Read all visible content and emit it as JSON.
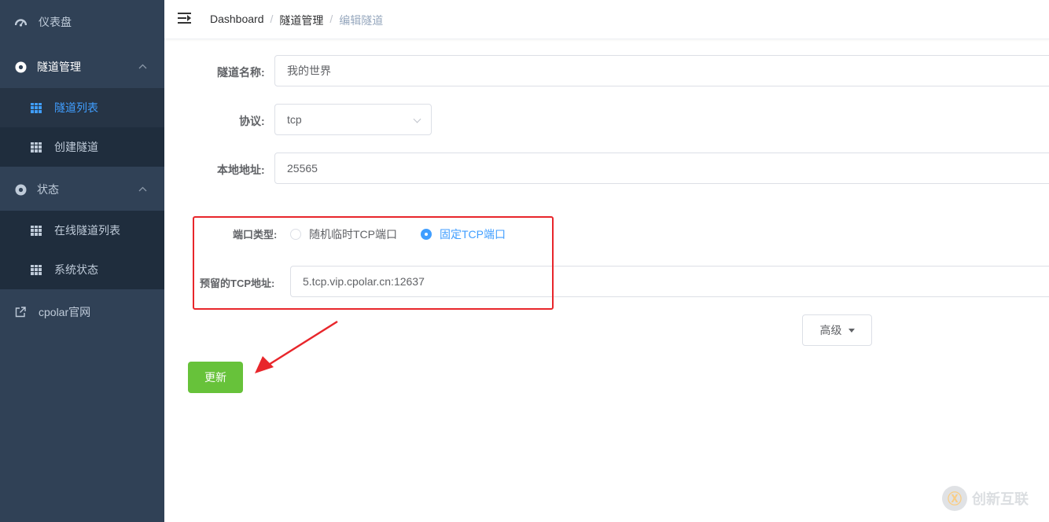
{
  "sidebar": {
    "dashboard": {
      "label": "仪表盘",
      "icon": "dashboard-gauge-icon"
    },
    "tunnel_group": {
      "label": "隧道管理",
      "icon": "disc-icon",
      "items": [
        {
          "label": "隧道列表",
          "icon": "grid-icon",
          "active": true
        },
        {
          "label": "创建隧道",
          "icon": "grid-icon"
        }
      ]
    },
    "status_group": {
      "label": "状态",
      "icon": "disc-icon",
      "items": [
        {
          "label": "在线隧道列表",
          "icon": "grid-icon"
        },
        {
          "label": "系统状态",
          "icon": "grid-icon"
        }
      ]
    },
    "external_link": {
      "label": "cpolar官网",
      "icon": "external-link-icon"
    }
  },
  "header": {
    "breadcrumb": [
      "Dashboard",
      "隧道管理",
      "编辑隧道"
    ],
    "separator": "/"
  },
  "form": {
    "name": {
      "label": "隧道名称:",
      "value": "我的世界"
    },
    "protocol": {
      "label": "协议:",
      "value": "tcp"
    },
    "local_address": {
      "label": "本地地址:",
      "value": "25565"
    },
    "port_type": {
      "label": "端口类型:",
      "options": [
        "随机临时TCP端口",
        "固定TCP端口"
      ],
      "selected": "固定TCP端口"
    },
    "reserved_tcp": {
      "label": "预留的TCP地址:",
      "value": "5.tcp.vip.cpolar.cn:12637"
    },
    "advanced_label": "高级",
    "submit_label": "更新"
  },
  "watermark": {
    "text": "创新互联",
    "logo_glyph": "Ⓧ"
  },
  "colors": {
    "sidebar_bg": "#304156",
    "active": "#409eff",
    "success": "#67c23a",
    "highlight": "#e8262b"
  }
}
